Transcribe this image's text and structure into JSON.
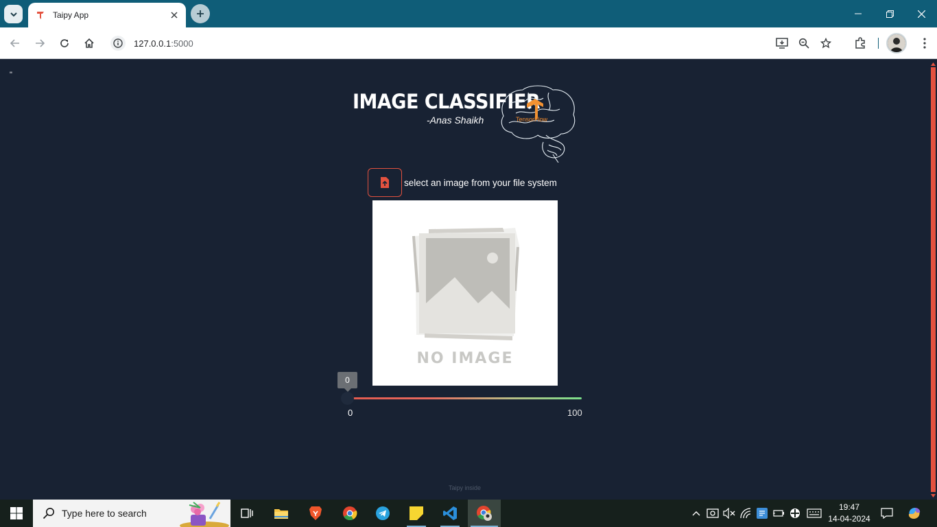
{
  "browser": {
    "tab_title": "Taipy App",
    "url_host": "127.0.0.1",
    "url_port": ":5000",
    "icons": [
      "tab-search-icon",
      "taipy-favicon-icon",
      "close-icon",
      "plus-icon",
      "minimize-icon",
      "restore-icon",
      "close-window-icon",
      "back-icon",
      "forward-icon",
      "reload-icon",
      "home-icon",
      "site-info-icon",
      "install-app-icon",
      "zoom-icon",
      "star-icon",
      "extensions-icon",
      "avatar",
      "more-icon"
    ]
  },
  "page": {
    "quote_mark": "\"",
    "logo": {
      "title": "IMAGE CLASSIFIER",
      "subtitle": "-Anas Shaikh",
      "badge": "TensorFlow"
    },
    "upload": {
      "label": "select an image from your file system"
    },
    "preview": {
      "placeholder_text": "NO IMAGE"
    },
    "slider": {
      "value": 0,
      "value_label": "0",
      "min_label": "0",
      "max_label": "100",
      "min": 0,
      "max": 100
    },
    "footer": "Taipy inside"
  },
  "taskbar": {
    "search_placeholder": "Type here to search",
    "apps": [
      "task-view",
      "file-explorer",
      "brave",
      "chrome",
      "telegram",
      "sticky-notes",
      "vscode",
      "chrome-active"
    ],
    "clock_time": "19:47",
    "clock_date": "14-04-2024"
  },
  "colors": {
    "accent": "#e4523f",
    "page_bg": "#182233",
    "titlebar": "#0f5d78"
  }
}
